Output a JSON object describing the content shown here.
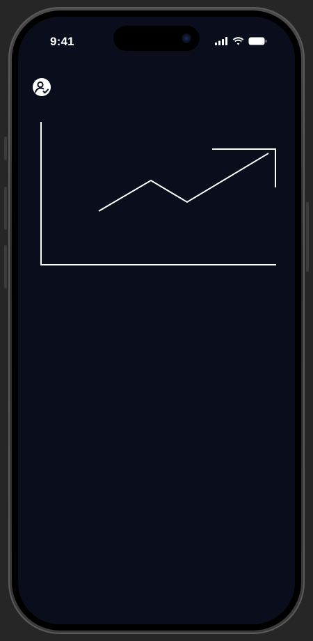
{
  "status_bar": {
    "time": "9:41",
    "icons": [
      "cellular-signal-icon",
      "wifi-icon",
      "battery-icon"
    ]
  },
  "header": {
    "avatar_icon": "user-profile-icon"
  },
  "illustration": {
    "icon": "trending-up-chart-icon",
    "stroke_color": "#ffffff"
  },
  "colors": {
    "screen_background": "#0a0e1c",
    "foreground": "#ffffff"
  }
}
